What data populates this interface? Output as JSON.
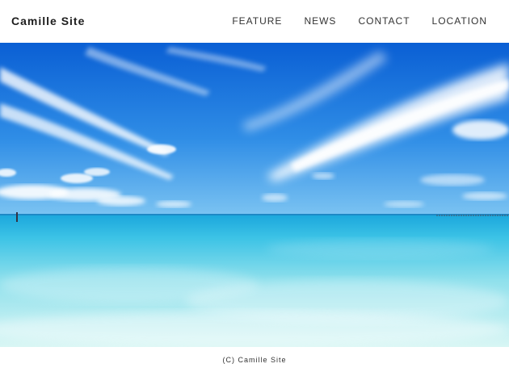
{
  "header": {
    "site_title": "Camille Site",
    "nav": [
      {
        "label": "FEATURE"
      },
      {
        "label": "NEWS"
      },
      {
        "label": "CONTACT"
      },
      {
        "label": "LOCATION"
      }
    ]
  },
  "hero": {
    "image_subject": "beach-sea-sky-photo",
    "colors": {
      "sky_top": "#0b63d6",
      "sky_bottom": "#5fb3f0",
      "sea_far": "#31b7e6",
      "sea_near": "#bfeef2"
    }
  },
  "footer": {
    "copyright": "(C) Camille Site"
  }
}
